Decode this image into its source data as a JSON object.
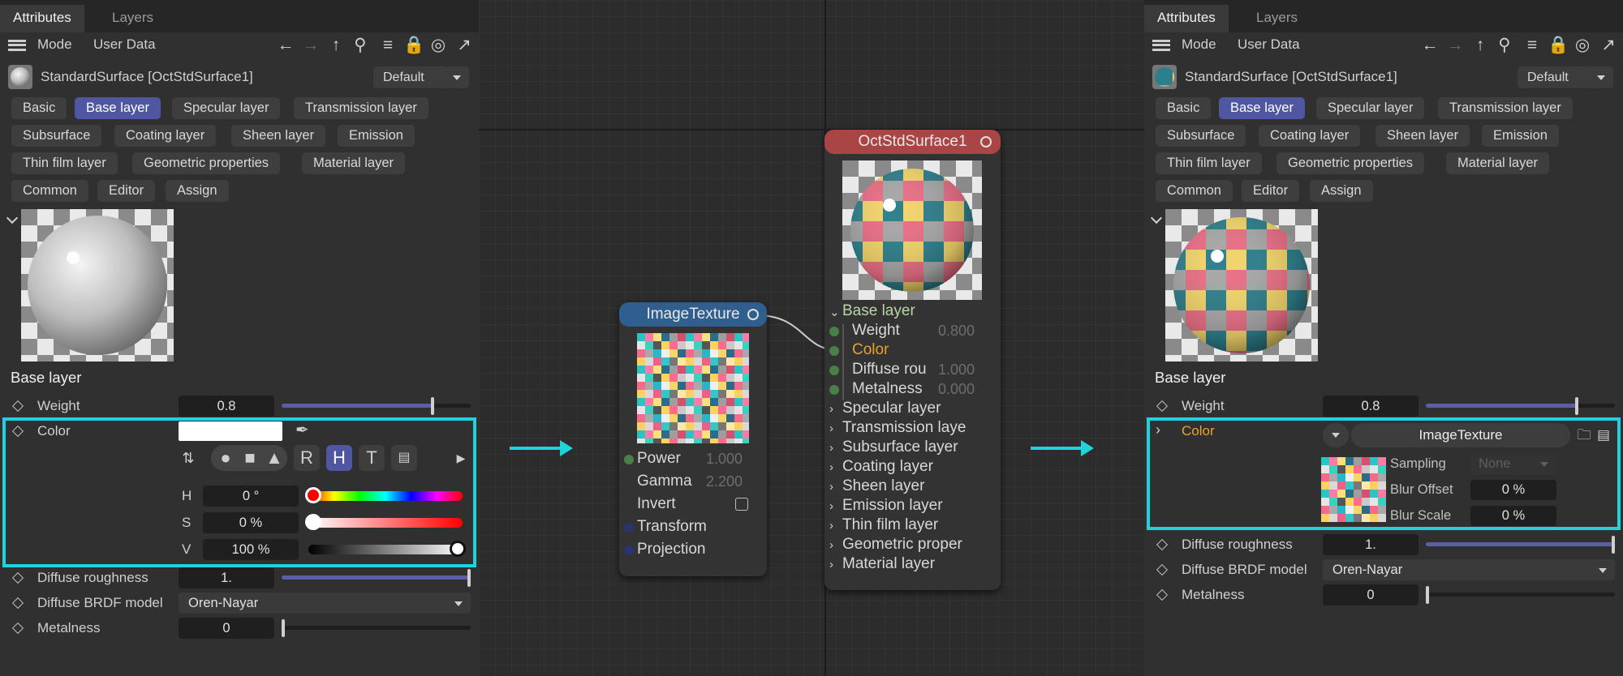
{
  "colors": {
    "accent": "#4f56a2",
    "highlight": "#1fd3dc",
    "material_header": "#a94545",
    "texture_header": "#2f5f8f",
    "port_green": "#4a7f4a",
    "port_navy": "#2a3570",
    "selected_text": "#e8a32c"
  },
  "left": {
    "tabs": [
      "Attributes",
      "Layers"
    ],
    "toolbar": {
      "mode": "Mode",
      "user_data": "User Data"
    },
    "object_name": "StandardSurface [OctStdSurface1]",
    "preset": "Default",
    "chips": [
      "Basic",
      "Base layer",
      "Specular layer",
      "Transmission layer",
      "Subsurface",
      "Coating layer",
      "Sheen layer",
      "Emission",
      "Thin film layer",
      "Geometric properties",
      "Material layer",
      "Common",
      "Editor",
      "Assign"
    ],
    "section": "Base layer",
    "weight": {
      "label": "Weight",
      "value": "0.8",
      "fraction": 0.8
    },
    "color": {
      "label": "Color"
    },
    "picker": {
      "r": "R",
      "h": "H",
      "t": "T"
    },
    "hsv": [
      {
        "label": "H",
        "value": "0 °"
      },
      {
        "label": "S",
        "value": "0 %"
      },
      {
        "label": "V",
        "value": "100 %"
      }
    ],
    "diffuse_roughness": {
      "label": "Diffuse roughness",
      "value": "1.",
      "fraction": 1.0
    },
    "brdf": {
      "label": "Diffuse BRDF model",
      "value": "Oren-Nayar"
    },
    "metalness": {
      "label": "Metalness",
      "value": "0",
      "fraction": 0.0
    }
  },
  "texture_node": {
    "title": "ImageTexture",
    "rows": [
      {
        "label": "Power",
        "value": "1.000"
      },
      {
        "label": "Gamma",
        "value": "2.200"
      },
      {
        "label": "Invert",
        "value": ""
      },
      {
        "label": "Transform",
        "value": ""
      },
      {
        "label": "Projection",
        "value": ""
      }
    ]
  },
  "material_node": {
    "title": "OctStdSurface1",
    "open_group": "Base layer",
    "inputs": [
      {
        "label": "Weight",
        "value": "0.800"
      },
      {
        "label": "Color",
        "value": ""
      },
      {
        "label": "Diffuse rou",
        "value": "1.000"
      },
      {
        "label": "Metalness",
        "value": "0.000"
      }
    ],
    "groups": [
      "Specular layer",
      "Transmission laye",
      "Subsurface layer",
      "Coating layer",
      "Sheen layer",
      "Emission layer",
      "Thin film layer",
      "Geometric proper",
      "Material layer"
    ]
  },
  "right": {
    "tabs": [
      "Attributes",
      "Layers"
    ],
    "toolbar": {
      "mode": "Mode",
      "user_data": "User Data"
    },
    "object_name": "StandardSurface [OctStdSurface1]",
    "preset": "Default",
    "chips": [
      "Basic",
      "Base layer",
      "Specular layer",
      "Transmission layer",
      "Subsurface",
      "Coating layer",
      "Sheen layer",
      "Emission",
      "Thin film layer",
      "Geometric properties",
      "Material layer",
      "Common",
      "Editor",
      "Assign"
    ],
    "section": "Base layer",
    "weight": {
      "label": "Weight",
      "value": "0.8",
      "fraction": 0.8
    },
    "color": {
      "label": "Color",
      "shader": "ImageTexture"
    },
    "sampling": {
      "label": "Sampling",
      "value": "None"
    },
    "blur_offset": {
      "label": "Blur Offset",
      "value": "0 %"
    },
    "blur_scale": {
      "label": "Blur Scale",
      "value": "0 %"
    },
    "diffuse_roughness": {
      "label": "Diffuse roughness",
      "value": "1.",
      "fraction": 1.0
    },
    "brdf": {
      "label": "Diffuse BRDF model",
      "value": "Oren-Nayar"
    },
    "metalness": {
      "label": "Metalness",
      "value": "0",
      "fraction": 0.0
    }
  }
}
